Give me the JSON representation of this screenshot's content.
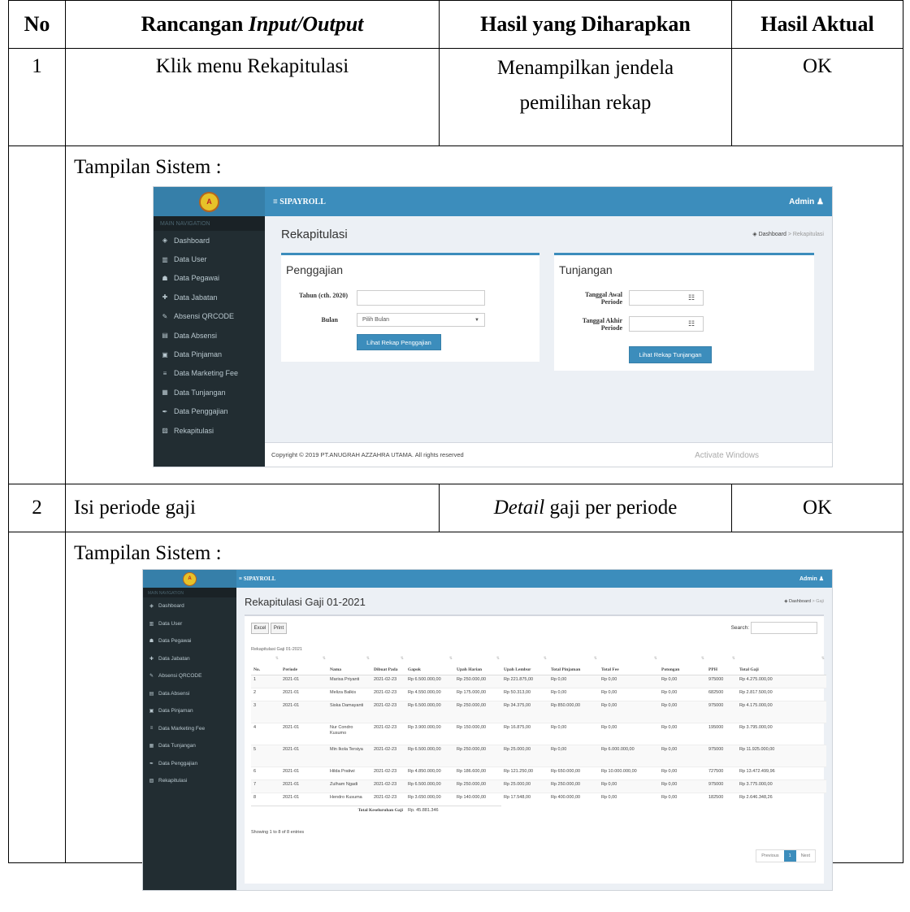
{
  "headers": {
    "no": "No",
    "io_prefix": "Rancangan ",
    "io_italic": "Input/Output",
    "expected": "Hasil yang Diharapkan",
    "actual": "Hasil Aktual"
  },
  "rows": [
    {
      "no": "1",
      "io": "Klik menu Rekapitulasi",
      "expected_line1": "Menampilkan jendela",
      "expected_line2": "pemilihan rekap",
      "actual": "OK",
      "caption": "Tampilan Sistem :"
    },
    {
      "no": "2",
      "io": "Isi periode gaji",
      "expected_italic": "Detail",
      "expected_rest": " gaji per periode",
      "actual": "OK",
      "caption": "Tampilan Sistem :"
    }
  ],
  "app": {
    "brand": "≡ SIPAYROLL",
    "admin": "Admin",
    "nav_header": "MAIN NAVIGATION",
    "nav": [
      {
        "icon": "dashboard-icon",
        "glyph": "◈",
        "label": "Dashboard"
      },
      {
        "icon": "user-icon",
        "glyph": "▥",
        "label": "Data User"
      },
      {
        "icon": "users-icon",
        "glyph": "☗",
        "label": "Data Pegawai"
      },
      {
        "icon": "briefcase-icon",
        "glyph": "✚",
        "label": "Data Jabatan"
      },
      {
        "icon": "pencil-icon",
        "glyph": "✎",
        "label": "Absensi QRCODE"
      },
      {
        "icon": "calendar-icon",
        "glyph": "▤",
        "label": "Data Absensi"
      },
      {
        "icon": "money-icon",
        "glyph": "▣",
        "label": "Data Pinjaman"
      },
      {
        "icon": "list-icon",
        "glyph": "≡",
        "label": "Data Marketing Fee"
      },
      {
        "icon": "table-icon",
        "glyph": "▦",
        "label": "Data Tunjangan"
      },
      {
        "icon": "pen-icon",
        "glyph": "✒",
        "label": "Data Penggajian"
      },
      {
        "icon": "chart-icon",
        "glyph": "▨",
        "label": "Rekapitulasi"
      }
    ]
  },
  "screen1": {
    "title": "Rekapitulasi",
    "crumb_home": "Dashboard",
    "crumb_sep": ">",
    "crumb_current": "Rekapitulasi",
    "pay": {
      "title": "Penggajian",
      "year_label": "Tahun (cth. 2020)",
      "year_value": "",
      "month_label": "Bulan",
      "month_placeholder": "Pilih Bulan",
      "button": "Lihat Rekap Penggajian"
    },
    "tun": {
      "title": "Tunjangan",
      "start_label": "Tanggal Awal Periode",
      "end_label": "Tanggal Akhir Periode",
      "button": "Lihat Rekap Tunjangan"
    },
    "footer": "Copyright © 2019 PT.ANUGRAH AZZAHRA UTAMA. All rights reserved",
    "watermark": "Activate Windows"
  },
  "screen2": {
    "title": "Rekapitulasi Gaji 01-2021",
    "crumb_home": "Dashboard",
    "crumb_sep": ">",
    "crumb_current": "Gaji",
    "btn_excel": "Excel",
    "btn_print": "Print",
    "search_label": "Search:",
    "caption": "Rekapitulasi Gaji 01-2021",
    "columns": [
      "No.",
      "Periode",
      "Nama",
      "Dibuat Pada",
      "Gapok",
      "Upah Harian",
      "Upah Lembur",
      "Total Pinjaman",
      "Total Fee",
      "Potongan",
      "PPH",
      "Total Gaji"
    ],
    "rows": [
      [
        "1",
        "2021-01",
        "Marisa Priyanti",
        "2021-02-23",
        "Rp 6.500.000,00",
        "Rp 250.000,00",
        "Rp 221.875,00",
        "Rp 0,00",
        "Rp 0,00",
        "Rp 0,00",
        "975000",
        "Rp 4.275.000,00"
      ],
      [
        "2",
        "2021-01",
        "Meliza Balkis",
        "2021-02-23",
        "Rp 4.550.000,00",
        "Rp 175.000,00",
        "Rp 50.313,00",
        "Rp 0,00",
        "Rp 0,00",
        "Rp 0,00",
        "682500",
        "Rp 2.817.500,00"
      ],
      [
        "3",
        "2021-01",
        "Siska Damayanti",
        "2021-02-23",
        "Rp 6.500.000,00",
        "Rp 250.000,00",
        "Rp 34.375,00",
        "Rp 850.000,00",
        "Rp 0,00",
        "Rp 0,00",
        "975000",
        "Rp 4.175.000,00"
      ],
      [
        "4",
        "2021-01",
        "Nur Condro Kusumo",
        "2021-02-23",
        "Rp 3.900.000,00",
        "Rp 150.000,00",
        "Rp 16.875,00",
        "Rp 0,00",
        "Rp 0,00",
        "Rp 0,00",
        "195000",
        "Rp 3.795.000,00"
      ],
      [
        "5",
        "2021-01",
        "Min Ikola Tersiya",
        "2021-02-23",
        "Rp 6.500.000,00",
        "Rp 250.000,00",
        "Rp 25.000,00",
        "Rp 0,00",
        "Rp 6.000.000,00",
        "Rp 0,00",
        "975000",
        "Rp 11.925.000,00"
      ],
      [
        "6",
        "2021-01",
        "Hilda Pratiwi",
        "2021-02-23",
        "Rp 4.850.000,00",
        "Rp 186.600,00",
        "Rp 121.250,00",
        "Rp 650.000,00",
        "Rp 10.000.000,00",
        "Rp 0,00",
        "727500",
        "Rp 13.472.499,96"
      ],
      [
        "7",
        "2021-01",
        "Zulham Ngadi",
        "2021-02-23",
        "Rp 6.500.000,00",
        "Rp 250.000,00",
        "Rp 25.000,00",
        "Rp 250.000,00",
        "Rp 0,00",
        "Rp 0,00",
        "975000",
        "Rp 3.775.000,00"
      ],
      [
        "8",
        "2021-01",
        "Hendro Kusuma",
        "2021-02-23",
        "Rp 3.650.000,00",
        "Rp 140.000,00",
        "Rp 17.548,00",
        "Rp 400.000,00",
        "Rp 0,00",
        "Rp 0,00",
        "182500",
        "Rp 2.646.348,26"
      ]
    ],
    "total_label": "Total Keseluruhan Gaji",
    "total_value": "Rp. 45.881.346",
    "showing": "Showing 1 to 8 of 8 entries",
    "pager_prev": "Previous",
    "pager_page": "1",
    "pager_next": "Next"
  }
}
